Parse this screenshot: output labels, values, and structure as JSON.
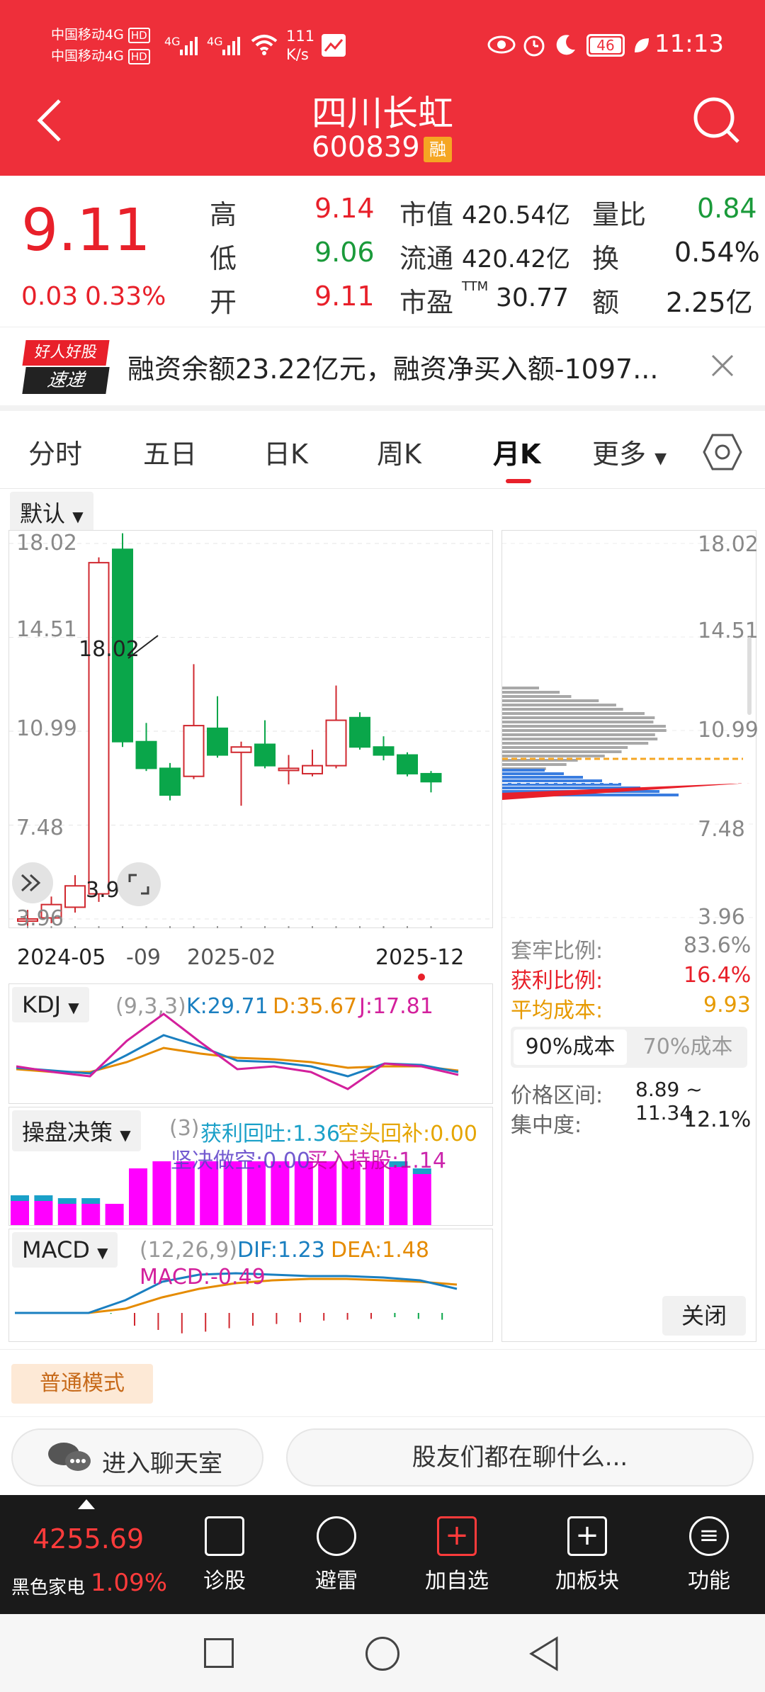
{
  "status": {
    "carrier1": "中国移动4G",
    "carrier2": "中国移动4G",
    "hd": "HD",
    "net1": "4G",
    "net2": "4G",
    "speed_value": "111",
    "speed_unit": "K/s",
    "battery": "46",
    "time": "11:13"
  },
  "header": {
    "title": "四川长虹",
    "code": "600839",
    "badge": "融"
  },
  "quote": {
    "price": "9.11",
    "change": "0.03",
    "change_pct": "0.33%",
    "high_label": "高",
    "high": "9.14",
    "low_label": "低",
    "low": "9.06",
    "open_label": "开",
    "open": "9.11",
    "mcap_label": "市值",
    "mcap": "420.54亿",
    "float_label": "流通",
    "float": "420.42亿",
    "pe_label": "市盈",
    "pe_sup": "TTM",
    "pe": "30.77",
    "vr_label": "量比",
    "vr": "0.84",
    "turn_label": "换",
    "turn": "0.54%",
    "amt_label": "额",
    "amt": "2.25亿"
  },
  "news": {
    "logo_top": "好人好股",
    "logo_bottom": "速递",
    "text": "融资余额23.22亿元，融资净买入额-1097..."
  },
  "tabs": [
    {
      "label": "分时"
    },
    {
      "label": "五日"
    },
    {
      "label": "日K"
    },
    {
      "label": "周K"
    },
    {
      "label": "月K"
    },
    {
      "label": "更多"
    }
  ],
  "chart": {
    "mode_label": "默认",
    "y_ticks": [
      "18.02",
      "14.51",
      "10.99",
      "7.48",
      "3.96"
    ],
    "annotation_high": "18.02",
    "annotation_low": "3.9",
    "x_labels": [
      "2024-05",
      "-09",
      "2025-02",
      "2025-12"
    ],
    "colors": {
      "up": "#d0282f",
      "down": "#0aa64a"
    }
  },
  "chart_data": {
    "type": "candlestick",
    "series": [
      {
        "o": 3.96,
        "c": 3.96,
        "h": 4.3,
        "l": 3.7
      },
      {
        "o": 4.0,
        "c": 4.5,
        "h": 4.8,
        "l": 3.8
      },
      {
        "o": 4.4,
        "c": 5.2,
        "h": 5.6,
        "l": 4.2
      },
      {
        "o": 4.9,
        "c": 17.3,
        "h": 17.5,
        "l": 4.6
      },
      {
        "o": 17.8,
        "c": 10.6,
        "h": 18.4,
        "l": 10.4
      },
      {
        "o": 10.6,
        "c": 9.6,
        "h": 11.3,
        "l": 9.5
      },
      {
        "o": 9.6,
        "c": 8.6,
        "h": 9.8,
        "l": 8.4
      },
      {
        "o": 9.3,
        "c": 11.2,
        "h": 13.5,
        "l": 9.2
      },
      {
        "o": 11.1,
        "c": 10.1,
        "h": 12.3,
        "l": 10.0
      },
      {
        "o": 10.2,
        "c": 10.4,
        "h": 10.6,
        "l": 8.2
      },
      {
        "o": 10.5,
        "c": 9.7,
        "h": 11.4,
        "l": 9.6
      },
      {
        "o": 9.6,
        "c": 9.6,
        "h": 10.1,
        "l": 9.0
      },
      {
        "o": 9.4,
        "c": 9.7,
        "h": 10.3,
        "l": 9.3
      },
      {
        "o": 9.7,
        "c": 11.4,
        "h": 12.7,
        "l": 9.6
      },
      {
        "o": 11.5,
        "c": 10.4,
        "h": 11.7,
        "l": 10.3
      },
      {
        "o": 10.4,
        "c": 10.1,
        "h": 10.8,
        "l": 9.9
      },
      {
        "o": 10.1,
        "c": 9.4,
        "h": 10.2,
        "l": 9.3
      },
      {
        "o": 9.4,
        "c": 9.1,
        "h": 9.5,
        "l": 8.7
      }
    ],
    "ylim": [
      3.96,
      18.02
    ]
  },
  "cost": {
    "y_ticks": [
      "18.02",
      "14.51",
      "10.99",
      "7.48",
      "3.96"
    ],
    "trap_label": "套牢比例:",
    "trap": "83.6%",
    "profit_label": "获利比例:",
    "profit": "16.4%",
    "avg_label": "平均成本:",
    "avg": "9.93",
    "tab90": "90%成本",
    "tab70": "70%成本",
    "range_label": "价格区间:",
    "range": "8.89 ~ 11.34",
    "conc_label": "集中度:",
    "conc": "12.1%",
    "close": "关闭"
  },
  "kdj": {
    "label": "KDJ",
    "params": "(9,3,3)",
    "k": "K:29.71",
    "d": "D:35.67",
    "j": "J:17.81"
  },
  "ops": {
    "label": "操盘决策",
    "params": "(3)",
    "a": "获利回吐:1.36",
    "b": "空头回补:0.00",
    "c": "坚决做空:0.00",
    "d": "买入持股:1.14"
  },
  "macd": {
    "label": "MACD",
    "params": "(12,26,9)",
    "dif": "DIF:1.23",
    "dea": "DEA:1.48",
    "macd": "MACD:-0.49"
  },
  "mode": {
    "label": "普通模式"
  },
  "chat": {
    "left": "进入聊天室",
    "right": "股友们都在聊什么..."
  },
  "bottom": {
    "index_value": "4255.69",
    "index_name": "黑色家电",
    "index_pct": "1.09%",
    "items": [
      "诊股",
      "避雷",
      "加自选",
      "加板块",
      "功能"
    ]
  }
}
